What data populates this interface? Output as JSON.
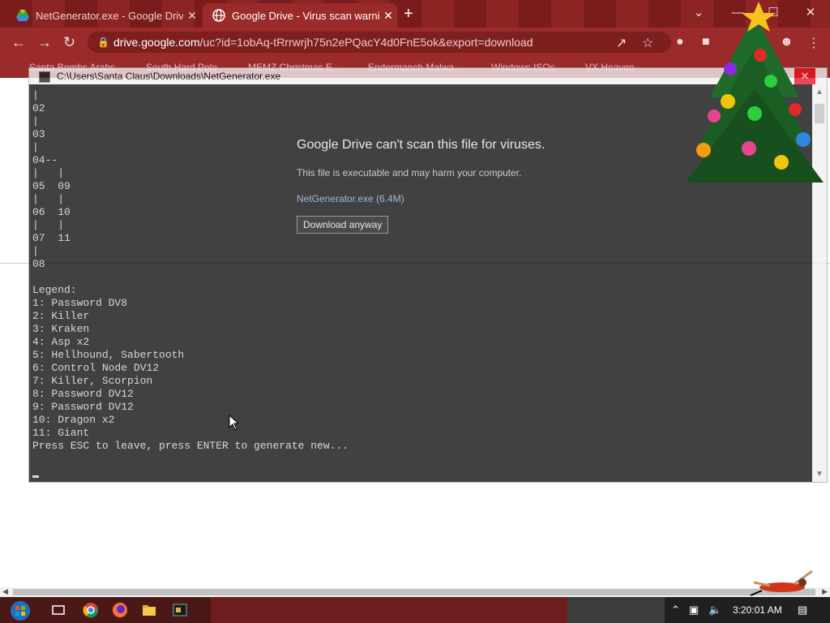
{
  "browser": {
    "tabs": [
      {
        "title": "NetGenerator.exe - Google Drive",
        "active": false
      },
      {
        "title": "Google Drive - Virus scan warnin",
        "active": true
      }
    ],
    "new_tab": "+",
    "tab_close": "✕",
    "window_controls": {
      "minimize": "—",
      "maximize": "☐",
      "close": "✕",
      "tab_search": "⌄"
    },
    "url_host": "drive.google.com",
    "url_path": "/uc?id=1obAq-tRrrwrjh75n2ePQacY4d0FnE5ok&export=download",
    "bookmarks": [
      "Santa Bombs Arabs",
      "South Hard Pole",
      "MEMZ Christmas E...",
      "Endermanch Malwa...",
      "Windows ISOs",
      "VX Heaven"
    ]
  },
  "drive_warning": {
    "heading": "Google Drive can't scan this file for viruses.",
    "subtext": "This file is executable and may harm your computer.",
    "file_link": "NetGenerator.exe (6.4M)",
    "download_button": "Download anyway"
  },
  "console": {
    "title": "C:\\Users\\Santa Claus\\Downloads\\NetGenerator.exe",
    "close": "✕",
    "lines": [
      "|",
      "02",
      "|",
      "03",
      "|",
      "04--",
      "|   |",
      "05  09",
      "|   |",
      "06  10",
      "|   |",
      "07  11",
      "|",
      "08",
      "",
      "Legend:",
      "1: Password DV8",
      "2: Killer",
      "3: Kraken",
      "4: Asp x2",
      "5: Hellhound, Sabertooth",
      "6: Control Node DV12",
      "7: Killer, Scorpion",
      "8: Password DV12",
      "9: Password DV12",
      "10: Dragon x2",
      "11: Giant",
      "Press ESC to leave, press ENTER to generate new..."
    ]
  },
  "taskbar": {
    "clock": "3:20:01 AM",
    "apps": [
      "start-orb-icon",
      "task-view-icon",
      "chrome-icon",
      "firefox-icon",
      "file-explorer-icon",
      "console-app-icon"
    ]
  },
  "colors": {
    "chrome_red": "#9b2a2a",
    "console_bg": "#0c0c0c",
    "console_text": "#cccccc",
    "close_red": "#e81123"
  }
}
